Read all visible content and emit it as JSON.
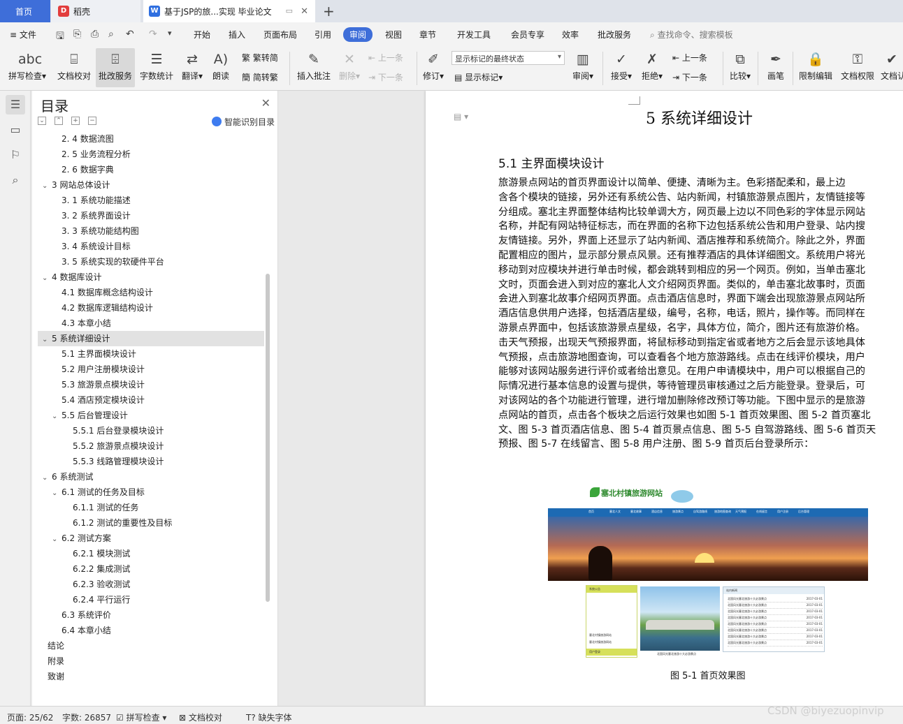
{
  "tabs": {
    "home": "首页",
    "daoke": "稻壳",
    "document": "基于JSP的旅...实现 毕业论文"
  },
  "menu": {
    "file": "文件",
    "items": [
      "开始",
      "插入",
      "页面布局",
      "引用",
      "审阅",
      "视图",
      "章节",
      "开发工具",
      "会员专享",
      "效率",
      "批改服务"
    ],
    "search": "查找命令、搜索模板"
  },
  "ribbon": {
    "spell_check": "拼写检查",
    "doc_proof": "文档校对",
    "correction_service": "批改服务",
    "word_count": "字数统计",
    "translate": "翻译",
    "read_aloud": "朗读",
    "trad_to_simp": "繁转简",
    "simp_to_trad": "简转繁",
    "insert_comment": "插入批注",
    "delete": "删除",
    "prev_comment": "上一条",
    "next_comment": "下一条",
    "revise": "修订",
    "markup_mode": "显示标记的最终状态",
    "show_markup": "显示标记",
    "review": "审阅",
    "accept": "接受",
    "reject": "拒绝",
    "prev_change": "上一条",
    "next_change": "下一条",
    "compare": "比较",
    "pen": "画笔",
    "restrict_edit": "限制编辑",
    "doc_permission": "文档权限",
    "doc_cert": "文档认"
  },
  "toc": {
    "title": "目录",
    "smart": "智能识别目录",
    "items": [
      {
        "text": "2. 4 数据流图",
        "level": 2
      },
      {
        "text": "2. 5 业务流程分析",
        "level": 2
      },
      {
        "text": "2. 6 数据字典",
        "level": 2
      },
      {
        "text": "3   网站总体设计",
        "level": 1,
        "expand": true
      },
      {
        "text": "3. 1 系统功能描述",
        "level": 2
      },
      {
        "text": "3. 2 系统界面设计",
        "level": 2
      },
      {
        "text": "3. 3 系统功能结构图",
        "level": 2
      },
      {
        "text": "3. 4 系统设计目标",
        "level": 2
      },
      {
        "text": "3. 5 系统实现的软硬件平台",
        "level": 2
      },
      {
        "text": "4   数据库设计",
        "level": 1,
        "expand": true
      },
      {
        "text": "4.1 数据库概念结构设计",
        "level": 2
      },
      {
        "text": "4.2 数据库逻辑结构设计",
        "level": 2
      },
      {
        "text": "4.3 本章小结",
        "level": 2
      },
      {
        "text": "5   系统详细设计",
        "level": 1,
        "expand": true,
        "selected": true
      },
      {
        "text": "5.1 主界面模块设计",
        "level": 2
      },
      {
        "text": "5.2 用户注册模块设计",
        "level": 2
      },
      {
        "text": "5.3 旅游景点模块设计",
        "level": 2
      },
      {
        "text": "5.4 酒店预定模块设计",
        "level": 2
      },
      {
        "text": "5.5 后台管理设计",
        "level": 2,
        "expand": true
      },
      {
        "text": "5.5.1 后台登录模块设计",
        "level": 3
      },
      {
        "text": "5.5.2 旅游景点模块设计",
        "level": 3
      },
      {
        "text": "5.5.3 线路管理模块设计",
        "level": 3
      },
      {
        "text": "6   系统测试",
        "level": 1,
        "expand": true
      },
      {
        "text": "6.1 测试的任务及目标",
        "level": 2,
        "expand": true
      },
      {
        "text": "6.1.1 测试的任务",
        "level": 3
      },
      {
        "text": "6.1.2 测试的重要性及目标",
        "level": 3
      },
      {
        "text": "6.2 测试方案",
        "level": 2,
        "expand": true
      },
      {
        "text": "6.2.1 模块测试",
        "level": 3
      },
      {
        "text": "6.2.2 集成测试",
        "level": 3
      },
      {
        "text": "6.2.3 验收测试",
        "level": 3
      },
      {
        "text": "6.2.4 平行运行",
        "level": 3
      },
      {
        "text": "6.3 系统评价",
        "level": 2
      },
      {
        "text": "6.4 本章小结",
        "level": 2
      },
      {
        "text": "结论",
        "level": 0
      },
      {
        "text": "附录",
        "level": 0
      },
      {
        "text": "致谢",
        "level": 0
      }
    ]
  },
  "document": {
    "chapter_title": "5   系统详细设计",
    "section_title": "5.1 主界面模块设计",
    "lines": [
      "    旅游景点网站的首页界面设计以简单、便捷、清晰为主。色彩搭配柔和，最上边",
      "含各个模块的链接，另外还有系统公告、站内新闻，村镇旅游景点图片，友情链接等",
      "分组成。塞北主界面整体结构比较单调大方，网页最上边以不同色彩的字体显示网站",
      "名称，并配有网站特征标志，而在界面的名称下边包括系统公告和用户登录、站内搜",
      "友情链接。另外，界面上还显示了站内新闻、酒店推荐和系统简介。除此之外，界面",
      "配置相应的图片，显示部分景点风景。还有推荐酒店的具体详细图文。系统用户将光",
      "移动到对应模块并进行单击时候，都会跳转到相应的另一个网页。例如，当单击塞北",
      "文时，页面会进入到对应的塞北人文介绍网页界面。类似的，单击塞北故事时，页面",
      "会进入到塞北故事介绍网页界面。点击酒店信息时，界面下端会出现旅游景点网站所",
      "酒店信息供用户选择，包括酒店星级，编号，名称，电话，照片，操作等。而同样在",
      "游景点界面中，包括该旅游景点星级，名字，具体方位，简介，图片还有旅游价格。",
      "击天气预报，出现天气预报界面，将鼠标移动到指定省或者地方之后会显示该地具体",
      "气预报，点击旅游地图查询，可以查看各个地方旅游路线。点击在线评价模块，用户",
      "能够对该网站服务进行评价或者给出意见。在用户申请模块中，用户可以根据自己的",
      "际情况进行基本信息的设置与提供，等待管理员审核通过之后方能登录。登录后，可",
      "对该网站的各个功能进行管理，进行增加删除修改预订等功能。下图中显示的是旅游",
      "点网站的首页，点击各个板块之后运行效果也如图 5-1 首页效果图、图 5-2 首页塞北",
      "文、图 5-3 首页酒店信息、图 5-4 首页景点信息、图 5-5 自驾游路线、图 5-6 首页天",
      "预报、图 5-7 在线留言、图 5-8 用户注册、图 5-9 首页后台登录所示："
    ],
    "figure": {
      "site_name": "塞北村镇旅游网站",
      "nav": [
        "首页",
        "塞北人文",
        "塞北故事",
        "酒店信息",
        "旅游景点",
        "自驾游路线",
        "旅游地图查询",
        "天气预报",
        "在线留言",
        "用户注册",
        "后台管理"
      ],
      "notice_head": "系统公告",
      "notice_lines": [
        "塞北村镇旅游网站",
        "塞北村镇旅游网站"
      ],
      "login_head": "用户登录",
      "photo_caption": "北国风光塞北旅游十大必游景点",
      "news_head": "站内新闻",
      "news": [
        {
          "title": "北国风光塞北旅游十大必游景点",
          "date": "2017-03-01"
        },
        {
          "title": "北国风光塞北旅游十大必游景点",
          "date": "2017-03-01"
        },
        {
          "title": "北国风光塞北旅游十大必游景点",
          "date": "2017-03-01"
        },
        {
          "title": "北国风光塞北旅游十大必游景点",
          "date": "2017-03-01"
        },
        {
          "title": "北国风光塞北旅游十大必游景点",
          "date": "2017-03-01"
        },
        {
          "title": "北国风光塞北旅游十大必游景点",
          "date": "2017-03-01"
        },
        {
          "title": "北国风光塞北旅游十大必游景点",
          "date": "2017-03-01"
        },
        {
          "title": "北国风光塞北旅游十大必游景点",
          "date": "2017-03-01"
        }
      ],
      "caption": "图 5-1 首页效果图"
    }
  },
  "status": {
    "page": "页面: 25/62",
    "words": "字数: 26857",
    "spell_check": "拼写检查",
    "doc_proof": "文档校对",
    "missing_font": "缺失字体"
  },
  "watermark": "CSDN @biyezuopinvip",
  "colors": {
    "accent": "#3e6ed9",
    "selected_row": "#e2e2e2"
  }
}
